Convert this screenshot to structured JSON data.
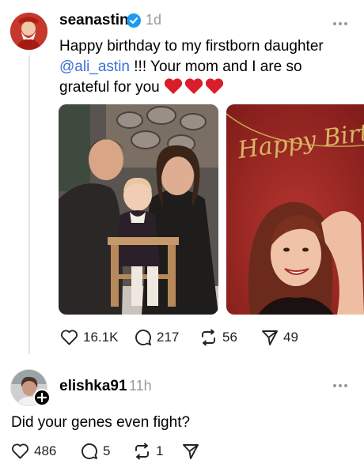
{
  "post": {
    "username": "seanastin",
    "time": "1d",
    "caption_part1": "Happy birthday to my firstborn daughter",
    "mention": "@ali_astin",
    "caption_part2": " !!! Your mom and I are so grateful for you",
    "stats": {
      "likes": "16.1K",
      "comments": "217",
      "reposts": "56",
      "shares": "49"
    },
    "banner_text": "Happy Birt"
  },
  "reply": {
    "username": "elishka91",
    "time": "11h",
    "text": "Did your genes even fight?",
    "stats": {
      "likes": "486",
      "comments": "5",
      "reposts": "1"
    }
  },
  "colors": {
    "verified": "#1d9bf0",
    "mention": "#3a6fd8",
    "heart": "#d91e2a"
  },
  "icons": [
    "verified-icon",
    "more-icon",
    "heart-icon",
    "comment-icon",
    "repost-icon",
    "share-icon",
    "follow-plus-icon"
  ]
}
